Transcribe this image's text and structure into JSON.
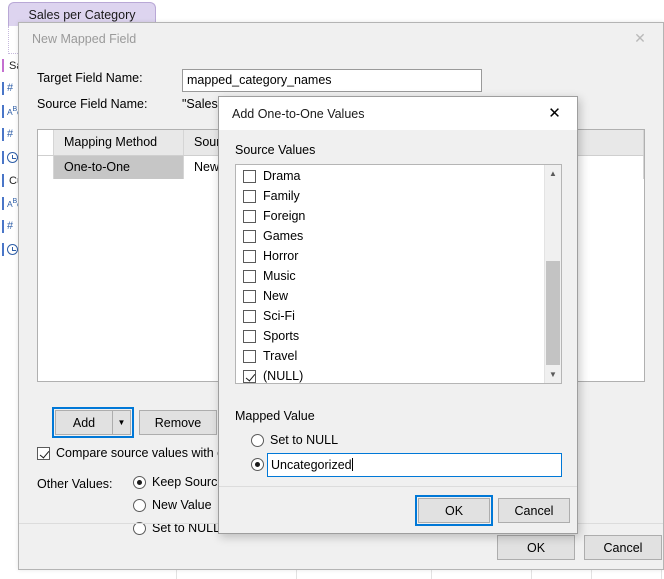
{
  "background": {
    "tab_label": "Sales per Category",
    "field_list": [
      {
        "icon": "color-swatch-icon",
        "label": "Sa"
      },
      {
        "icon": "number-field-icon",
        "label": ""
      },
      {
        "icon": "text-field-icon",
        "label": ""
      },
      {
        "icon": "number-field-icon",
        "label": ""
      },
      {
        "icon": "datetime-field-icon",
        "label": ""
      },
      {
        "icon": "link-icon",
        "label": "Cu"
      },
      {
        "icon": "text-field-icon",
        "label": ""
      },
      {
        "icon": "number-field-icon",
        "label": ""
      },
      {
        "icon": "datetime-field-icon",
        "label": ""
      }
    ],
    "grid_row_cells": [
      "",
      "",
      "",
      "",
      "",
      ""
    ]
  },
  "outer_dialog": {
    "title": "New Mapped Field",
    "close_icon": "close-icon",
    "target_field_label": "Target Field Name:",
    "target_field_value": "mapped_category_names",
    "source_field_label": "Source Field Name:",
    "source_field_value": "\"Sales p",
    "grid": {
      "columns": [
        "Mapping Method",
        "Source V"
      ],
      "rows": [
        [
          "One-to-One",
          "New"
        ]
      ]
    },
    "add_label": "Add",
    "add_dropdown_icon": "chevron-down-icon",
    "remove_label": "Remove",
    "compare_checkbox_label": "Compare source values with ca",
    "compare_checked": true,
    "other_values_label": "Other Values:",
    "other_values_options": [
      {
        "label": "Keep Source",
        "selected": true
      },
      {
        "label": "New Value",
        "selected": false
      },
      {
        "label": "Set to NULL",
        "selected": false
      }
    ],
    "ok_label": "OK",
    "cancel_label": "Cancel"
  },
  "inner_dialog": {
    "title": "Add One-to-One Values",
    "close_icon": "close-icon",
    "source_values_label": "Source Values",
    "source_values": [
      {
        "label": "Drama",
        "checked": false
      },
      {
        "label": "Family",
        "checked": false
      },
      {
        "label": "Foreign",
        "checked": false
      },
      {
        "label": "Games",
        "checked": false
      },
      {
        "label": "Horror",
        "checked": false
      },
      {
        "label": "Music",
        "checked": false
      },
      {
        "label": "New",
        "checked": false
      },
      {
        "label": "Sci-Fi",
        "checked": false
      },
      {
        "label": "Sports",
        "checked": false
      },
      {
        "label": "Travel",
        "checked": false
      },
      {
        "label": "(NULL)",
        "checked": true
      }
    ],
    "scroll_up_icon": "chevron-up-icon",
    "scroll_down_icon": "chevron-down-icon",
    "mapped_value_label": "Mapped Value",
    "set_to_null_label": "Set to NULL",
    "set_to_null_selected": false,
    "custom_value_selected": true,
    "custom_value": "Uncategorized",
    "ok_label": "OK",
    "cancel_label": "Cancel"
  },
  "colors": {
    "accent": "#0078d7",
    "tab": "#ddd4ef",
    "dialog_face": "#f0f0f0",
    "selection": "#c6c6c6"
  }
}
